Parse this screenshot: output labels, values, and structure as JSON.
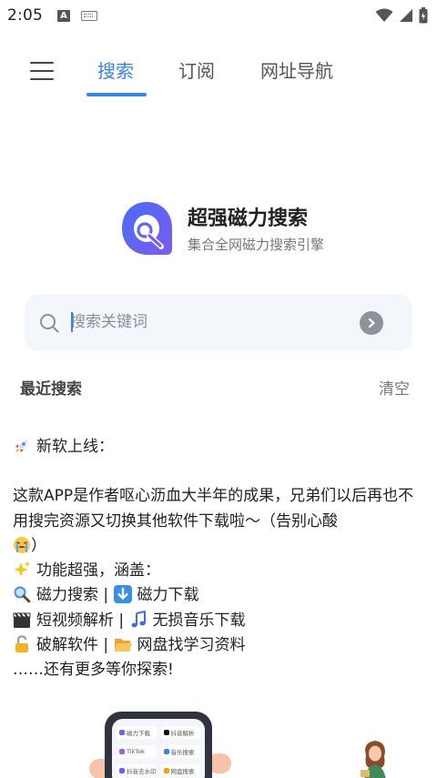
{
  "status_bar": {
    "time": "2:05",
    "icons": [
      "a-notification-icon",
      "keyboard-icon",
      "wifi-icon",
      "signal-icon",
      "battery-icon"
    ]
  },
  "nav": {
    "tabs": [
      {
        "label": "搜索",
        "active": true
      },
      {
        "label": "订阅",
        "active": false
      },
      {
        "label": "网址导航",
        "active": false
      }
    ]
  },
  "brand": {
    "title": "超强磁力搜索",
    "subtitle": "集合全网磁力搜索引擎"
  },
  "search": {
    "placeholder": "搜索关键词",
    "value": ""
  },
  "recent": {
    "title": "最近搜索",
    "clear_label": "清空"
  },
  "notice": {
    "headline": "新软上线：",
    "paragraph": "这款APP是作者呕心沥血大半年的成果，兄弟们以后再也不用搜完资源又切换其他软件下载啦～（告别心酸",
    "paragraph_end": "）",
    "features_title": "功能超强，涵盖：",
    "line1": "磁力搜索 | ",
    "line1b": "磁力下载",
    "line2": "短视频解析 | ",
    "line2b": "无损音乐下载",
    "line3": "破解软件 | ",
    "line3b": "网盘找学习资料",
    "footer": "……还有更多等你探索!"
  },
  "illustration": {
    "apps": [
      "磁力下载",
      "抖音解析",
      "TikTok",
      "音乐搜索",
      "抖音去水印",
      "网盘搜索"
    ]
  },
  "colors": {
    "accent": "#3b82e6",
    "logo_blue": "#4a6cf7",
    "logo_purple": "#7b5cf0",
    "search_bg": "#f3f6fb"
  }
}
